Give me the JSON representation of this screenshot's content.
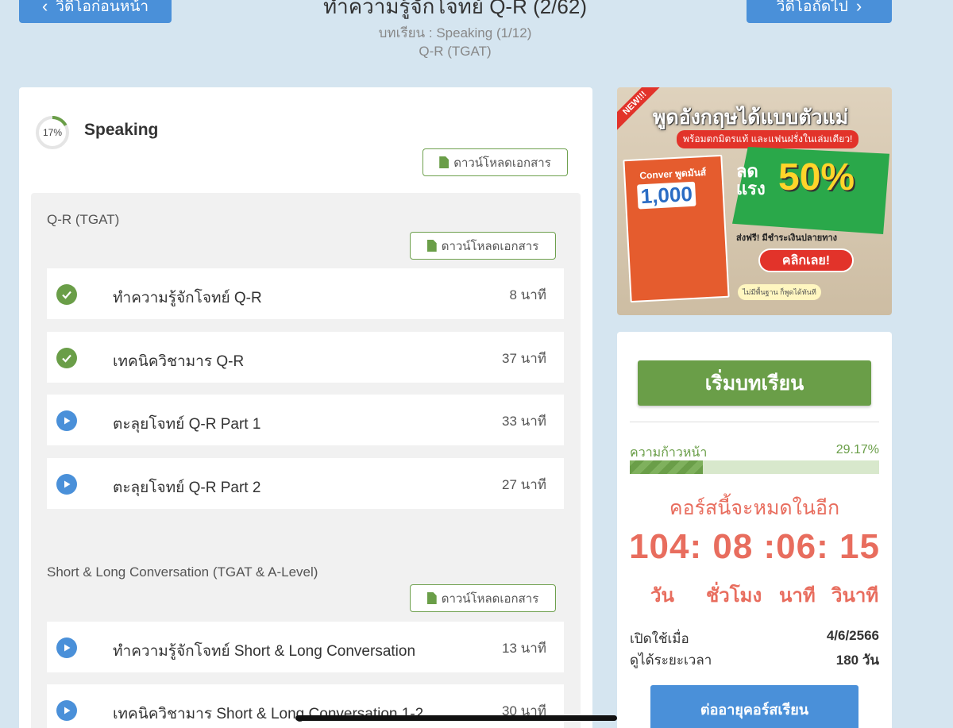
{
  "nav": {
    "prev_label": "วิดีโอก่อนหน้า",
    "next_label": "วิดีโอถัดไป",
    "lesson_title": "ทำความรู้จักโจทย์ Q-R (2/62)",
    "lesson_subtitle": "บทเรียน : Speaking (1/12)",
    "lesson_group": "Q-R (TGAT)"
  },
  "course": {
    "section_progress_label": "17%",
    "section_progress": 0.17,
    "section_title": "Speaking",
    "download_label": "ดาวน์โหลดเอกสาร",
    "groups": [
      {
        "title": "Q-R (TGAT)",
        "download_label": "ดาวน์โหลดเอกสาร",
        "lessons": [
          {
            "name": "ทำความรู้จักโจทย์ Q-R",
            "duration": "8 นาที",
            "status": "done"
          },
          {
            "name": "เทคนิควิชามาร Q-R",
            "duration": "37 นาที",
            "status": "done"
          },
          {
            "name": "ตะลุยโจทย์ Q-R Part 1",
            "duration": "33 นาที",
            "status": "play"
          },
          {
            "name": "ตะลุยโจทย์ Q-R Part 2",
            "duration": "27 นาที",
            "status": "play"
          }
        ]
      },
      {
        "title": "Short & Long Conversation (TGAT & A-Level)",
        "download_label": "ดาวน์โหลดเอกสาร",
        "lessons": [
          {
            "name": "ทำความรู้จักโจทย์ Short & Long Conversation",
            "duration": "13 นาที",
            "status": "play"
          },
          {
            "name": "เทคนิควิชามาร Short & Long Conversation 1-2",
            "duration": "30 นาที",
            "status": "play"
          }
        ]
      }
    ]
  },
  "ad": {
    "badge": "NEW!!!",
    "headline": "พูดอังกฤษได้แบบตัวแม่",
    "subline": "พร้อมตกมิตรแท้ และแฟนฝรั่งในเล่มเดียว!",
    "book_title": "Conver พูดมันส์",
    "book_number": "1,000",
    "discount_label_1": "ลด",
    "discount_label_2": "แรง",
    "discount_value": "50%",
    "shipping": "ส่งฟรี! มีชำระเงินปลายทาง",
    "cta": "คลิกเลย!",
    "note": "ไม่มีพื้นฐาน ก็พูดได้ทันที"
  },
  "info": {
    "start_label": "เริ่มบทเรียน",
    "progress_label": "ความก้าวหน้า",
    "progress_value": "29.17%",
    "progress": 0.2917,
    "expire_title": "คอร์สนี้จะหมดในอีก",
    "countdown": {
      "days": "104",
      "hours": "08",
      "minutes": "06",
      "seconds": "15"
    },
    "countdown_text": "104: 08 :06: 15",
    "units": {
      "days": "วัน",
      "hours": "ชั่วโมง",
      "minutes": "นาที",
      "seconds": "วินาที"
    },
    "open_label": "เปิดใช้เมื่อ",
    "open_value": "4/6/2566",
    "duration_label": "ดูได้ระยะเวลา",
    "duration_value": "180 วัน",
    "renew_label": "ต่ออายุคอร์สเรียน"
  },
  "colors": {
    "accent_green": "#6a9e48",
    "accent_blue": "#4a90d9",
    "countdown_red": "#e86d5e",
    "background": "#d5e5f0"
  }
}
